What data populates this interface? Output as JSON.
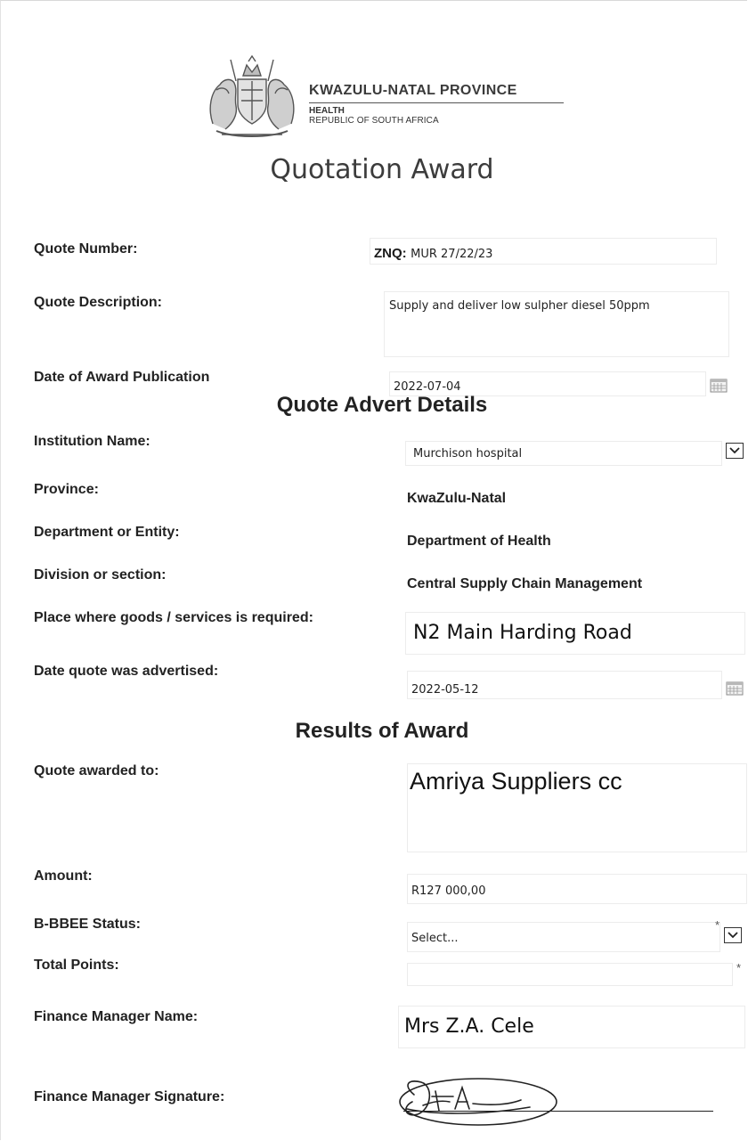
{
  "header": {
    "province_name": "KWAZULU-NATAL PROVINCE",
    "department": "HEALTH",
    "country": "REPUBLIC OF SOUTH AFRICA",
    "doc_title": "Quotation Award"
  },
  "quote": {
    "number_label": "Quote Number:",
    "number_prefix": "ZNQ:",
    "number_value": "MUR 27/22/23",
    "description_label": "Quote Description:",
    "description_value": "Supply and deliver low sulpher diesel 50ppm",
    "award_date_label": "Date of Award Publication",
    "award_date_value": "2022-07-04"
  },
  "advert": {
    "section_title": "Quote Advert Details",
    "institution_label": "Institution Name:",
    "institution_value": "Murchison hospital",
    "province_label": "Province:",
    "province_value": "KwaZulu-Natal",
    "department_label": "Department or Entity:",
    "department_value": "Department of Health",
    "division_label": "Division or section:",
    "division_value": "Central Supply Chain Management",
    "place_label": "Place where goods /  services is required:",
    "place_value": "N2 Main Harding Road",
    "advertised_label": "Date quote was advertised:",
    "advertised_value": "2022-05-12"
  },
  "results": {
    "section_title": "Results of Award",
    "awarded_to_label": "Quote awarded to:",
    "awarded_to_value": "Amriya Suppliers cc",
    "amount_label": "Amount:",
    "amount_value": "R127 000,00",
    "bbbee_label": "B-BBEE Status:",
    "bbbee_value": "Select...",
    "total_points_label": "Total Points:",
    "total_points_value": "",
    "required_mark": "*",
    "finance_manager_label": "Finance Manager Name:",
    "finance_manager_value": "Mrs Z.A. Cele",
    "signature_label": "Finance Manager Signature:"
  },
  "icons": {
    "calendar": "calendar-icon",
    "dropdown": "chevron-down-icon",
    "crest": "coat-of-arms-icon",
    "signature": "handwritten-signature"
  }
}
